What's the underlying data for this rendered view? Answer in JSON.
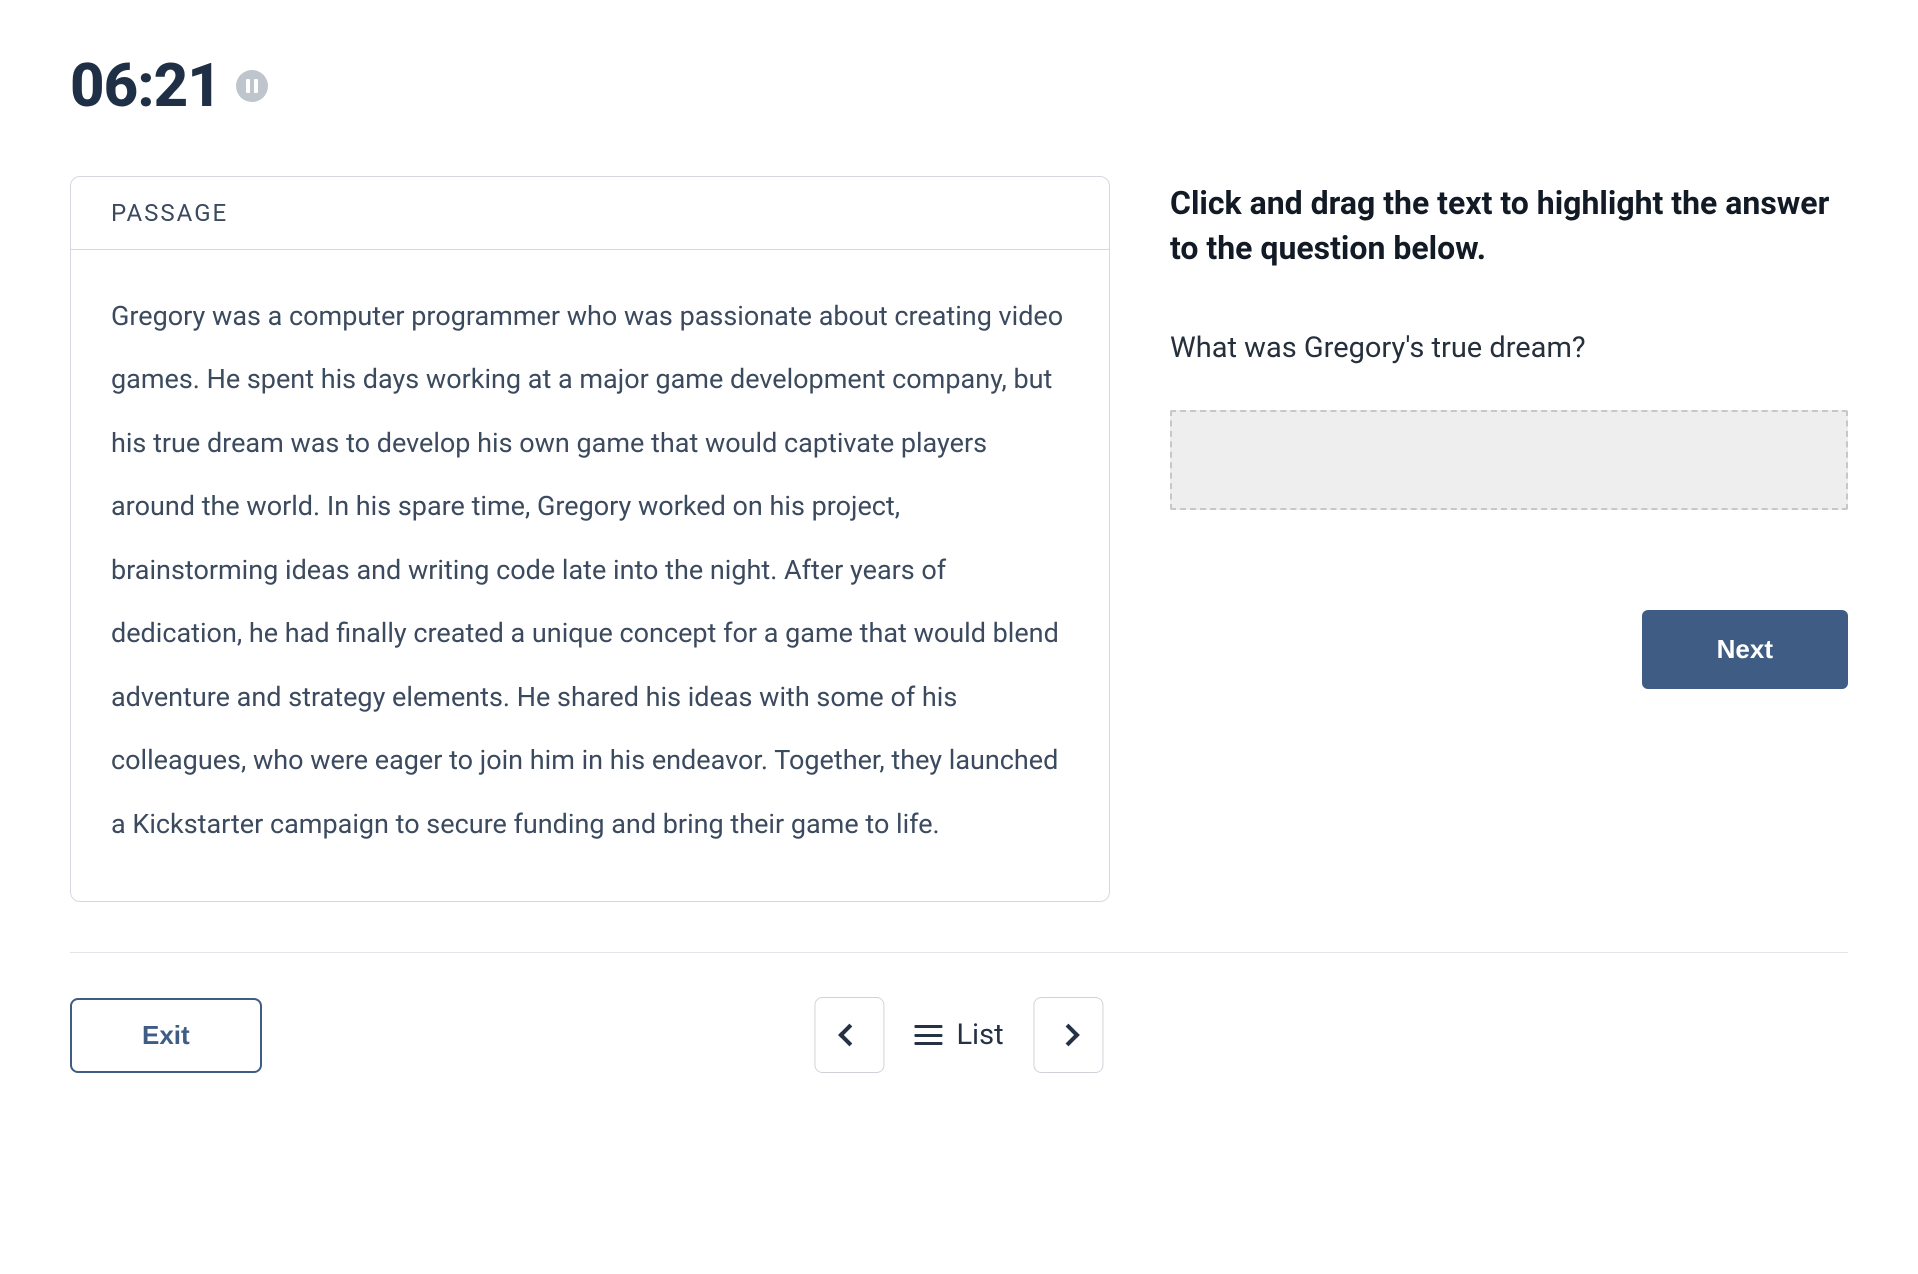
{
  "timer": {
    "display": "06:21"
  },
  "passage": {
    "header": "PASSAGE",
    "body": "Gregory was a computer programmer who was passionate about creating video games. He spent his days working at a major game development company, but his true dream was to develop his own game that would captivate players around the world. In his spare time, Gregory worked on his project, brainstorming ideas and writing code late into the night. After years of dedication, he had finally created a unique concept for a game that would blend adventure and strategy elements. He shared his ideas with some of his colleagues, who were eager to join him in his endeavor. Together, they launched a Kickstarter campaign to secure funding and bring their game to life."
  },
  "instruction": "Click and drag the text to highlight the answer to the question below.",
  "question": "What was Gregory's true dream?",
  "buttons": {
    "next": "Next",
    "exit": "Exit",
    "list": "List"
  }
}
